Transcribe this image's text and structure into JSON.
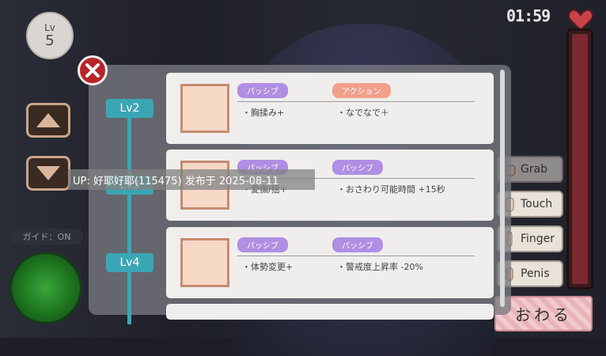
{
  "hud": {
    "level_label": "Lv",
    "level_value": "5",
    "timer": "01:59",
    "guide": "ガイド：ON"
  },
  "actions": {
    "grab": "Grab",
    "touch": "Touch",
    "finger": "Finger",
    "penis": "Penis",
    "finish": "おわる"
  },
  "skills_panel": {
    "rows": [
      {
        "level": "Lv2",
        "skills": [
          {
            "tag": "パッシブ",
            "desc": "・胸揉み+"
          },
          {
            "tag": "アクション",
            "desc": "・なでなで＋"
          }
        ]
      },
      {
        "level": "Lv3",
        "skills": [
          {
            "tag": "パッシブ",
            "desc": "・愛撫/揺+"
          },
          {
            "tag": "パッシブ",
            "desc": "・おさわり可能時間 +15秒"
          }
        ]
      },
      {
        "level": "Lv4",
        "skills": [
          {
            "tag": "パッシブ",
            "desc": "・体勢変更+"
          },
          {
            "tag": "パッシブ",
            "desc": "・警戒度上昇率 -20%"
          }
        ]
      }
    ]
  },
  "overlay": {
    "watermark": "UP: 好耶好耶(115475) 发布于 2025-08-11"
  },
  "colors": {
    "accent_teal": "#3aa6b5",
    "passive_tag": "#b08ee3",
    "action_tag": "#f2a08a",
    "close_red": "#b8242a"
  }
}
